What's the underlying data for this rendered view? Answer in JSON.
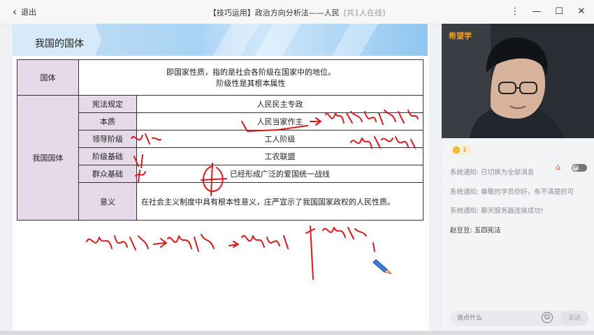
{
  "window": {
    "back_label": "退出",
    "title": "【技巧运用】政治方向分析法——人民",
    "online_count": "[共1人在线]"
  },
  "slide": {
    "title": "我国的国体",
    "table": {
      "row1": {
        "head": "国体",
        "text_line1": "即国家性质，指的是社会各阶级在国家中的地位。",
        "text_line2": "阶级性是其根本属性"
      },
      "section_head": "我国国体",
      "rows": [
        {
          "label": "宪法规定",
          "value": "人民民主专政"
        },
        {
          "label": "本质",
          "value": "人民当家作主"
        },
        {
          "label": "领导阶级",
          "value": "工人阶级"
        },
        {
          "label": "阶级基础",
          "value": "工农联盟"
        },
        {
          "label": "群众基础",
          "value": "已经形成广泛的爱国统一战线"
        },
        {
          "label": "意义",
          "value": "在社会主义制度中具有根本性意义，庄严宣示了我国国家政权的人民性质。"
        }
      ]
    }
  },
  "sidebar": {
    "brand": "希望学",
    "coins": "1",
    "messages": [
      {
        "text": "系统通知: 已切换为全部消息"
      },
      {
        "text": "系统通知: 尊敬的学员你好，有不清楚的可"
      },
      {
        "text": "系统通知: 聊天服务器连接成功!"
      }
    ],
    "user_message": {
      "name": "赵豆豆:",
      "text": "五四宪法"
    },
    "toggle_label": "师",
    "input_placeholder": "说点什么",
    "send_label": "发送"
  },
  "colors": {
    "accent": "#f6a11b",
    "table_header_bg": "#e6d9ea",
    "ink_red": "#e0181b"
  }
}
